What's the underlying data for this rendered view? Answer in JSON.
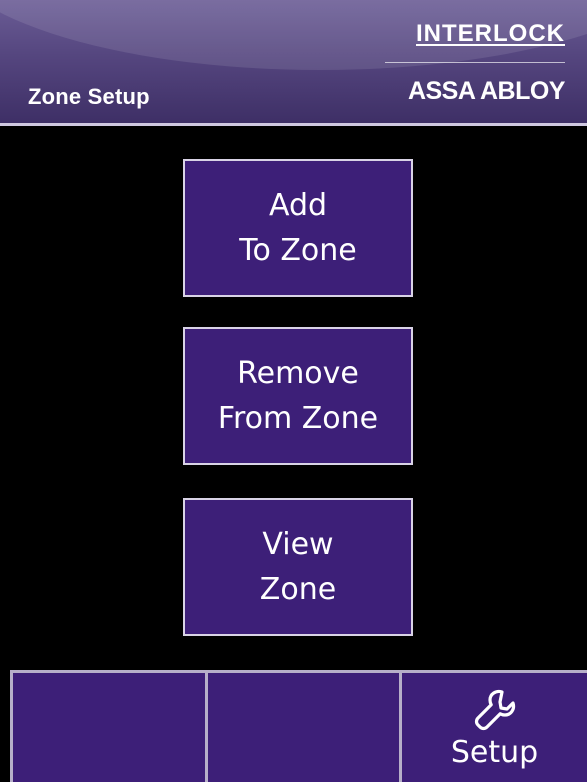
{
  "header": {
    "title": "Zone Setup",
    "brand_top": "INTERLOCK",
    "brand_bottom": "ASSA ABLOY"
  },
  "menu": {
    "add": {
      "line1": "Add",
      "line2": "To Zone"
    },
    "remove": {
      "line1": "Remove",
      "line2": "From Zone"
    },
    "view": {
      "line1": "View",
      "line2": "Zone"
    }
  },
  "bottom_bar": {
    "setup_label": "Setup",
    "setup_icon": "wrench-icon"
  },
  "colors": {
    "button_fill": "#3d1f78",
    "button_border": "#d9d3e6",
    "header_top": "#6b5d96",
    "header_bottom": "#3e2f66",
    "background": "#000000"
  }
}
